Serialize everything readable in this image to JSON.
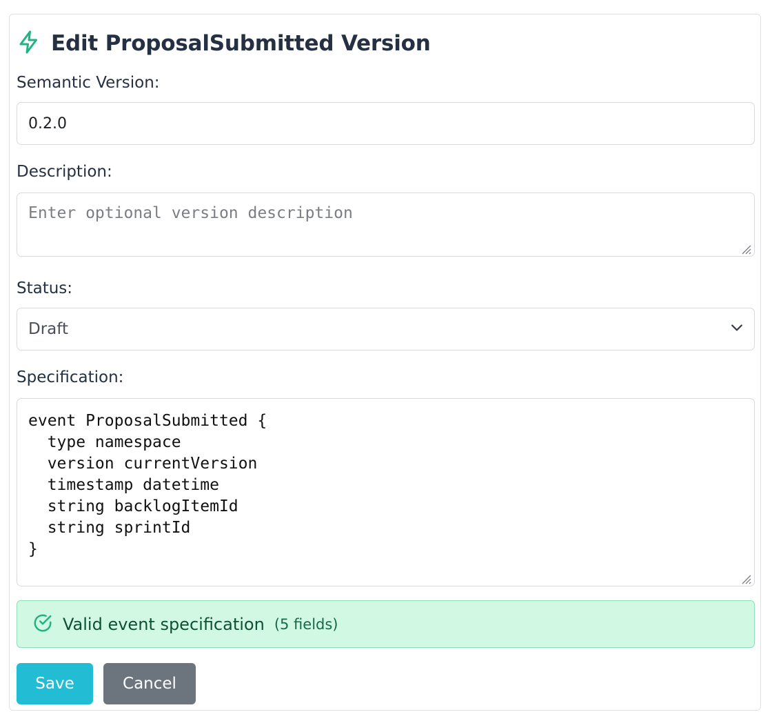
{
  "header": {
    "title": "Edit ProposalSubmitted Version",
    "icon": "lightning-bolt-icon"
  },
  "form": {
    "semantic_version_label": "Semantic Version:",
    "semantic_version_value": "0.2.0",
    "description_label": "Description:",
    "description_placeholder": "Enter optional version description",
    "status_label": "Status:",
    "status_value": "Draft",
    "specification_label": "Specification:",
    "specification_value": "event ProposalSubmitted {\n  type namespace\n  version currentVersion\n  timestamp datetime\n  string backlogItemId\n  string sprintId\n}"
  },
  "validation": {
    "message": "Valid event specification",
    "field_count": "(5 fields)",
    "icon": "check-circle-icon"
  },
  "actions": {
    "save_label": "Save",
    "cancel_label": "Cancel"
  },
  "colors": {
    "accent": "#22bcd4",
    "secondary": "#6c757d",
    "success_bg": "#d1f8e3",
    "success_text": "#0f5132",
    "bolt": "#20b483"
  }
}
